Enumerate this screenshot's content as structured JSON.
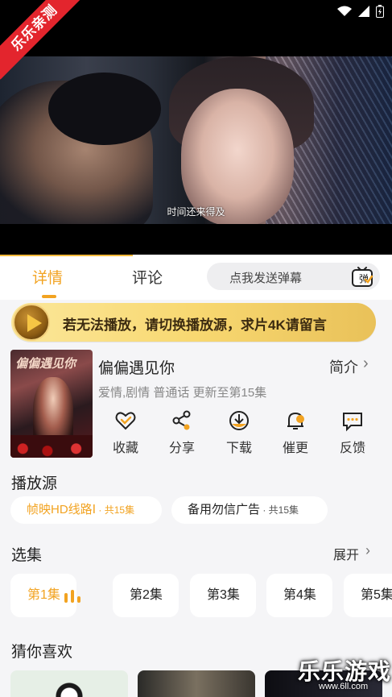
{
  "player": {
    "subtitle": "时间还来得及",
    "corner_ribbon": "乐乐亲测",
    "status_icons": [
      "wifi-icon",
      "signal-icon",
      "battery-charging-icon"
    ]
  },
  "tabs": {
    "detail": "详情",
    "comment": "评论",
    "danmaku_placeholder": "点我发送弹幕",
    "danmaku_icon_label": "弹"
  },
  "banner": {
    "text": "若无法播放，请切换播放源，求片4K请留言"
  },
  "show": {
    "poster_title": "偏偏遇见你",
    "title": "偏偏遇见你",
    "intro_link": "简介",
    "meta": "爱情,剧情 普通话 更新至第15集",
    "actions": [
      {
        "label": "收藏",
        "icon": "heart-check-icon"
      },
      {
        "label": "分享",
        "icon": "share-icon"
      },
      {
        "label": "下载",
        "icon": "download-icon"
      },
      {
        "label": "催更",
        "icon": "bell-icon"
      },
      {
        "label": "反馈",
        "icon": "feedback-icon"
      }
    ]
  },
  "sources": {
    "title": "播放源",
    "items": [
      {
        "name": "帧映HD线路Ⅰ",
        "count": " · 共15集"
      },
      {
        "name": "备用勿信广告",
        "count": " · 共15集"
      }
    ]
  },
  "episodes": {
    "title": "选集",
    "expand": "展开",
    "items": [
      "第1集",
      "第2集",
      "第3集",
      "第4集",
      "第5集"
    ],
    "active_index": 0
  },
  "recommend": {
    "title": "猜你喜欢"
  },
  "watermark": {
    "brand": "乐乐游戏",
    "url": "www.6ll.com"
  },
  "colors": {
    "accent": "#f2a321",
    "ribbon": "#e3252d",
    "background": "#f5f5f7"
  }
}
